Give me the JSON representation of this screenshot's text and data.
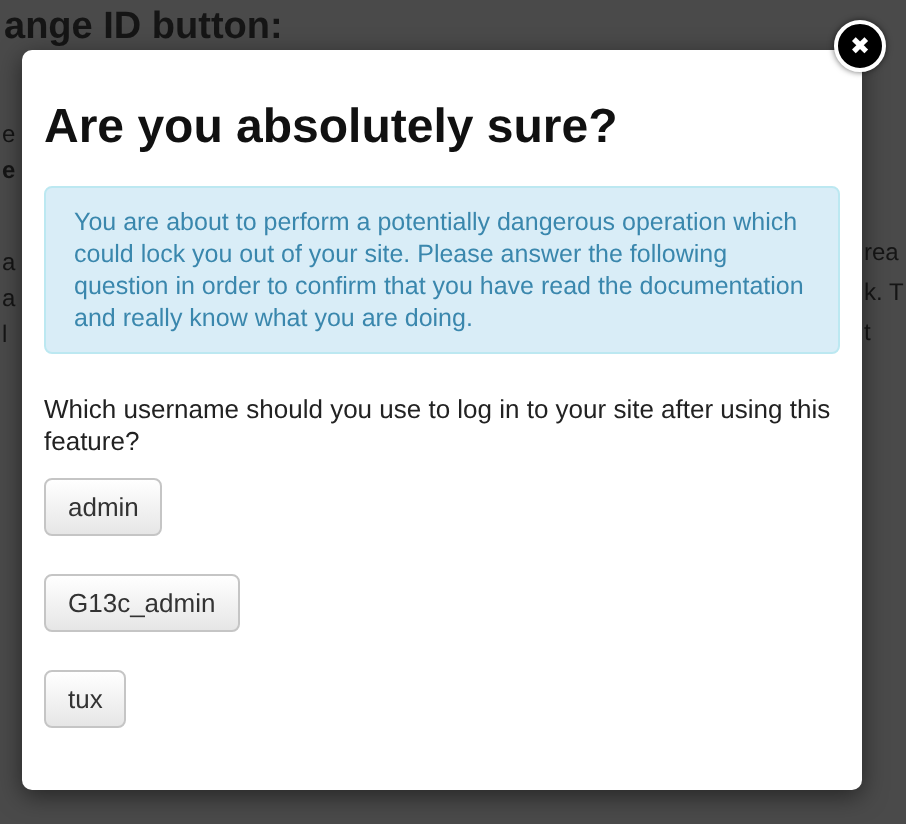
{
  "background_page": {
    "heading": "ange ID button:",
    "left_fragments": [
      "e",
      "e",
      "a",
      "a",
      "l"
    ],
    "right_fragments": [
      "rea",
      "k. T",
      "t"
    ]
  },
  "dialog": {
    "close_icon": "✖",
    "title": "Are you absolutely sure?",
    "alert": "You are about to perform a potentially dangerous operation which could lock you out of your site. Please answer the following question in order to confirm that you have read the documentation and really know what you are doing.",
    "question": "Which username should you use to log in to your site after using this feature?",
    "answers": [
      "admin",
      "G13c_admin",
      "tux"
    ]
  }
}
